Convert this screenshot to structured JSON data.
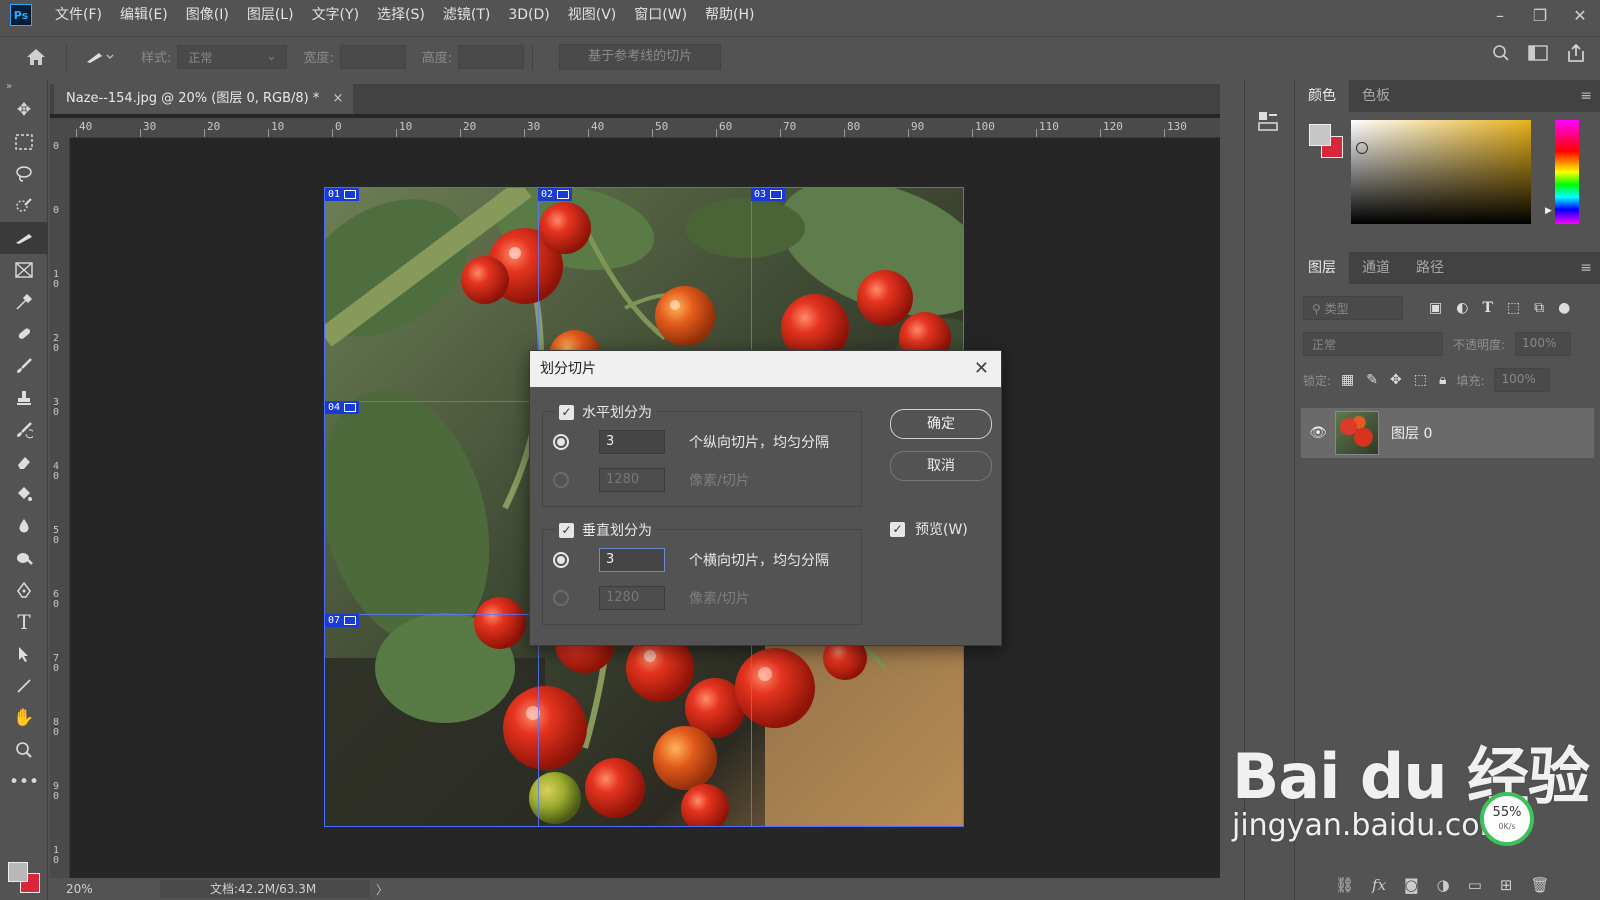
{
  "app": {
    "logo": "Ps",
    "menu": [
      "文件(F)",
      "编辑(E)",
      "图像(I)",
      "图层(L)",
      "文字(Y)",
      "选择(S)",
      "滤镜(T)",
      "3D(D)",
      "视图(V)",
      "窗口(W)",
      "帮助(H)"
    ]
  },
  "options_bar": {
    "style_label": "样式:",
    "style_value": "正常",
    "width_label": "宽度:",
    "height_label": "高度:",
    "guides_button": "基于参考线的切片"
  },
  "document": {
    "tab_title": "Naze--154.jpg @ 20% (图层 0, RGB/8) *",
    "close": "×",
    "ruler_top": [
      "40",
      "30",
      "20",
      "10",
      "0",
      "10",
      "20",
      "30",
      "40",
      "50",
      "60",
      "70",
      "80",
      "90",
      "100",
      "110",
      "120",
      "130"
    ],
    "ruler_left": [
      "0",
      "0",
      "1 0",
      "2 0",
      "3 0",
      "4 0",
      "5 0",
      "6 0",
      "7 0",
      "8 0",
      "9 0",
      "1 0"
    ],
    "slices": [
      "01",
      "02",
      "03",
      "04",
      "07"
    ]
  },
  "status": {
    "zoom": "20%",
    "doc_size": "文档:42.2M/63.3M",
    "arrow": "〉"
  },
  "color_panel": {
    "tabs": [
      "颜色",
      "色板"
    ]
  },
  "layers_panel": {
    "tabs": [
      "图层",
      "通道",
      "路径"
    ],
    "filter_placeholder": "类型",
    "blend_mode": "正常",
    "opacity_label": "不透明度:",
    "opacity_value": "100%",
    "lock_label": "锁定:",
    "fill_label": "填充:",
    "fill_value": "100%",
    "layer_name": "图层 0"
  },
  "dialog": {
    "title": "划分切片",
    "horizontal": {
      "label": "水平划分为",
      "count": "3",
      "count_suffix": "个纵向切片，均匀分隔",
      "pixels": "1280",
      "pixels_suffix": "像素/切片"
    },
    "vertical": {
      "label": "垂直划分为",
      "count": "3",
      "count_suffix": "个横向切片，均匀分隔",
      "pixels": "1280",
      "pixels_suffix": "像素/切片"
    },
    "ok": "确定",
    "cancel": "取消",
    "preview": "预览(W)"
  },
  "watermark": {
    "main": "Bai du 经验",
    "url": "jingyan.baidu.com"
  },
  "net_badge": {
    "percent": "55%",
    "speed": "0K/s"
  }
}
